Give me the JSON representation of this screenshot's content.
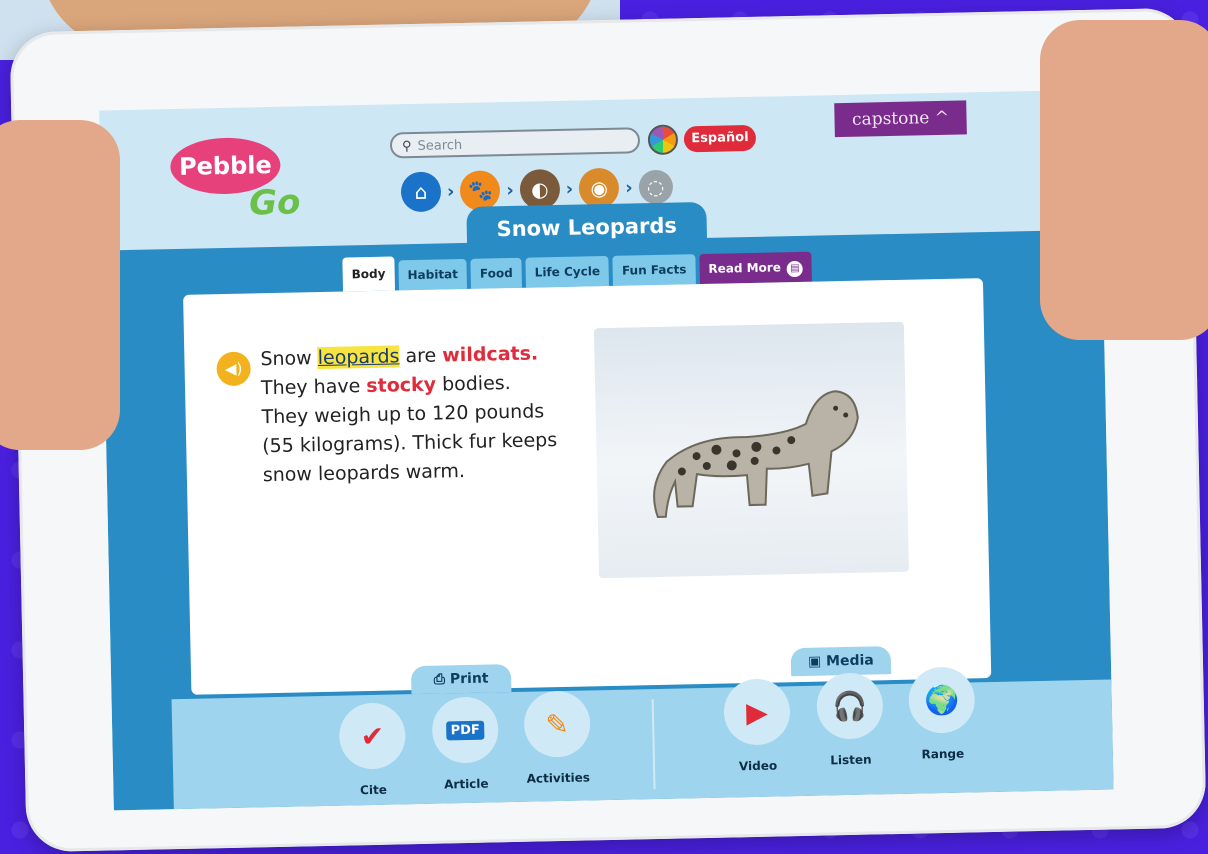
{
  "app": {
    "logo_top": "Pebble",
    "logo_bottom": "Go",
    "search_placeholder": "Search",
    "language_button": "Español",
    "brand": "capstone ^"
  },
  "breadcrumb": {
    "items": [
      "home-icon",
      "paw-icon",
      "animal-icon",
      "tiger-icon",
      "snow-leopard-icon"
    ]
  },
  "page": {
    "title": "Snow Leopards",
    "tabs": [
      "Body",
      "Habitat",
      "Food",
      "Life Cycle",
      "Fun Facts",
      "Read More"
    ],
    "active_tab": "Body"
  },
  "article": {
    "sentence1_start": "Snow ",
    "vocab_word": "leopards",
    "sentence1_mid": " are ",
    "highlight1": "wildcats.",
    "sentence2_start": "They have ",
    "highlight2": "stocky",
    "sentence2_end": " bodies.",
    "sentence3": "They weigh up to 120 pounds (55 kilograms). Thick fur keeps snow leopards warm."
  },
  "toolbar": {
    "print_label": "Print",
    "media_label": "Media",
    "tools": [
      "Cite",
      "Article",
      "Activities",
      "Video",
      "Listen",
      "Range"
    ]
  }
}
